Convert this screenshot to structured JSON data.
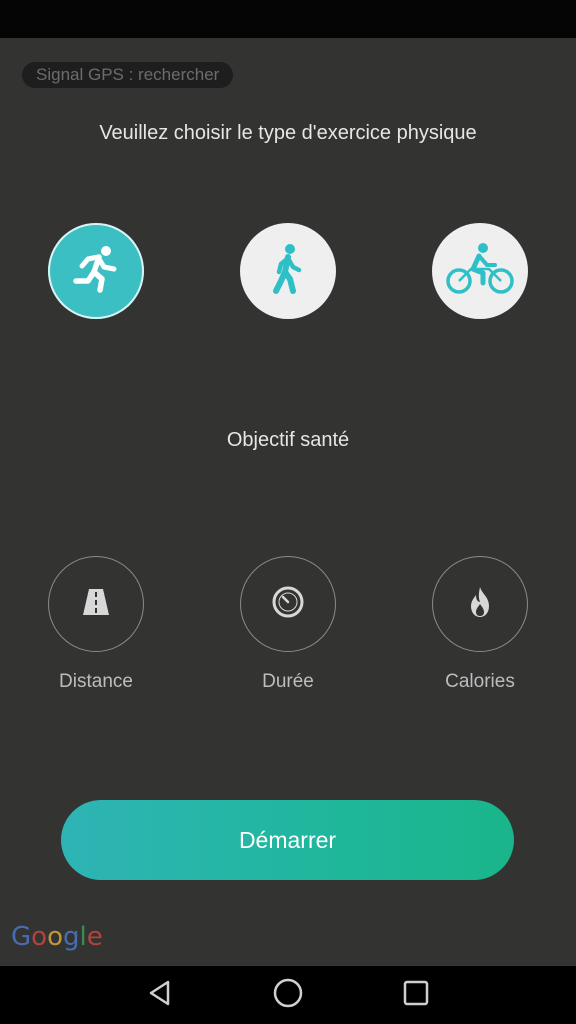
{
  "gps_status": "Signal GPS : rechercher",
  "prompt": "Veuillez choisir le type d'exercice physique",
  "exercise_types": [
    {
      "icon": "running-icon",
      "selected": true
    },
    {
      "icon": "walking-icon",
      "selected": false
    },
    {
      "icon": "cycling-icon",
      "selected": false
    }
  ],
  "goal_title": "Objectif santé",
  "goals": [
    {
      "label": "Distance",
      "icon": "road-icon"
    },
    {
      "label": "Durée",
      "icon": "stopwatch-icon"
    },
    {
      "label": "Calories",
      "icon": "flame-icon"
    }
  ],
  "start_label": "Démarrer",
  "logo": {
    "letters": [
      "G",
      "o",
      "o",
      "g",
      "l",
      "e"
    ],
    "colors": [
      "#4a76c9",
      "#c4473f",
      "#d6a93a",
      "#4a76c9",
      "#3f9a57",
      "#c4473f"
    ]
  },
  "colors": {
    "accent": "#3bbfc3",
    "background": "#333332",
    "button_gradient_start": "#2fb4b5",
    "button_gradient_end": "#1ab58a"
  },
  "navbar": [
    "back-icon",
    "home-icon",
    "recents-icon"
  ]
}
